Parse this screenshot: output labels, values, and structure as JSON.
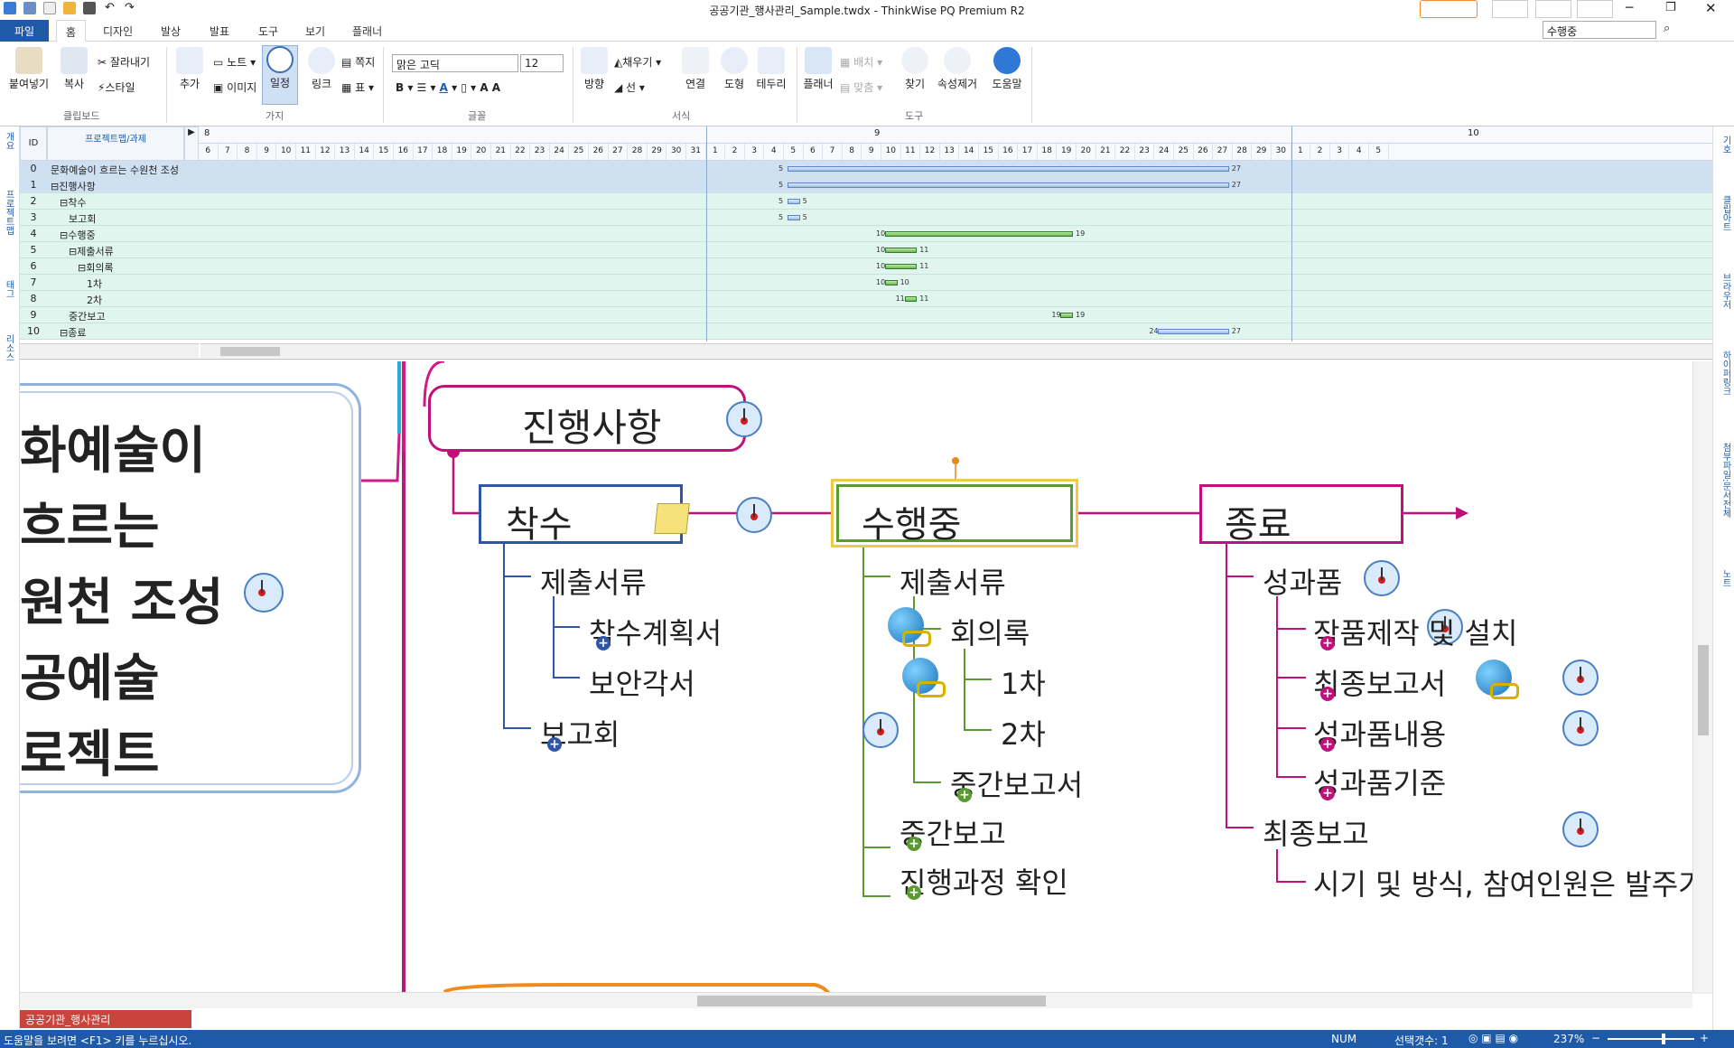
{
  "window": {
    "title": "공공기관_행사관리_Sample.twdx - ThinkWise PQ Premium R2",
    "search_value": "수행중"
  },
  "tabs": [
    "파일",
    "홈",
    "디자인",
    "발상",
    "발표",
    "도구",
    "보기",
    "플래너"
  ],
  "ribbon": {
    "clipboard": {
      "paste": "붙여넣기",
      "copy": "복사",
      "cut": "잘라내기",
      "style": "스타일",
      "group": "클립보드"
    },
    "branch": {
      "add": "추가",
      "note": "노트",
      "image": "이미지",
      "schedule": "일정",
      "link": "링크",
      "memo": "쪽지",
      "table": "표",
      "group": "가지"
    },
    "font": {
      "name": "맑은 고딕",
      "size": "12",
      "group": "글꼴"
    },
    "format": {
      "direction": "방향",
      "fill": "채우기",
      "line": "선",
      "connect": "연결",
      "shape": "도형",
      "border": "테두리",
      "group": "서식"
    },
    "tools": {
      "planner": "플래너",
      "arrange": "배치",
      "align": "맞춤",
      "find": "찾기",
      "clear": "속성제거",
      "help": "도움말",
      "group": "도구"
    }
  },
  "leftbar": [
    "개요",
    "프로젝트맵",
    "태그",
    "리소스"
  ],
  "rightbar": [
    "기호",
    "클립아트",
    "브라우저",
    "하이퍼링크",
    "첨부파일:문서전체",
    "노트"
  ],
  "gantt": {
    "header_id": "ID",
    "header_task": "프로젝트맵/과제",
    "month_labels": [
      "8",
      "9",
      "10"
    ],
    "days_aug": [
      "6",
      "7",
      "8",
      "9",
      "10",
      "11",
      "12",
      "13",
      "14",
      "15",
      "16",
      "17",
      "18",
      "19",
      "20",
      "21",
      "22",
      "23",
      "24",
      "25",
      "26",
      "27",
      "28",
      "29",
      "30",
      "31"
    ],
    "days_sep": [
      "1",
      "2",
      "3",
      "4",
      "5",
      "6",
      "7",
      "8",
      "9",
      "10",
      "11",
      "12",
      "13",
      "14",
      "15",
      "16",
      "17",
      "18",
      "19",
      "20",
      "21",
      "22",
      "23",
      "24",
      "25",
      "26",
      "27",
      "28",
      "29",
      "30"
    ],
    "days_oct": [
      "1",
      "2",
      "3",
      "4",
      "5"
    ],
    "rows": [
      {
        "id": "0",
        "task": "문화예술이 흐르는 수원천 조성 ...",
        "start": "5",
        "end": "27",
        "kind": "blue"
      },
      {
        "id": "1",
        "task": "⊟진행사항",
        "start": "5",
        "end": "27",
        "kind": "blue"
      },
      {
        "id": "2",
        "task": "⊟착수",
        "start": "5",
        "end": "5",
        "kind": "blue"
      },
      {
        "id": "3",
        "task": "보고회",
        "start": "5",
        "end": "5",
        "kind": "blue"
      },
      {
        "id": "4",
        "task": "⊟수행중",
        "start": "10",
        "end": "19",
        "kind": "green"
      },
      {
        "id": "5",
        "task": "⊟제출서류",
        "start": "10",
        "end": "11",
        "kind": "green"
      },
      {
        "id": "6",
        "task": "⊟회의록",
        "start": "10",
        "end": "11",
        "kind": "green"
      },
      {
        "id": "7",
        "task": "1차",
        "start": "10",
        "end": "10",
        "kind": "green"
      },
      {
        "id": "8",
        "task": "2차",
        "start": "11",
        "end": "11",
        "kind": "green"
      },
      {
        "id": "9",
        "task": "중간보고",
        "start": "19",
        "end": "19",
        "kind": "green"
      },
      {
        "id": "10",
        "task": "⊟종료",
        "start": "24",
        "end": "27",
        "kind": "blue"
      }
    ]
  },
  "map": {
    "root_lines": [
      "화예술이",
      "흐르는",
      "원천 조성",
      "공예술",
      "로젝트"
    ],
    "main": "진행사항",
    "branches": {
      "start": {
        "title": "착수",
        "children": [
          "제출서류",
          "착수계획서",
          "보안각서",
          "보고회"
        ]
      },
      "progress": {
        "title": "수행중",
        "children": [
          "제출서류",
          "회의록",
          "1차",
          "2차",
          "중간보고서",
          "중간보고",
          "진행과정 확인"
        ]
      },
      "end": {
        "title": "종료",
        "children": [
          "성과품",
          "작품제작 및 설치",
          "최종보고서",
          "성과품내용",
          "성과품기준",
          "최종보고",
          "시기 및 방식, 참여인원은 발주기"
        ]
      }
    }
  },
  "doc_tab": "공공기관_행사관리_Sample.twdx",
  "status": {
    "help": "도움말을 보려면 <F1> 키를 누르십시오.",
    "num": "NUM",
    "selection": "선택갯수: 1",
    "zoom": "237%"
  }
}
